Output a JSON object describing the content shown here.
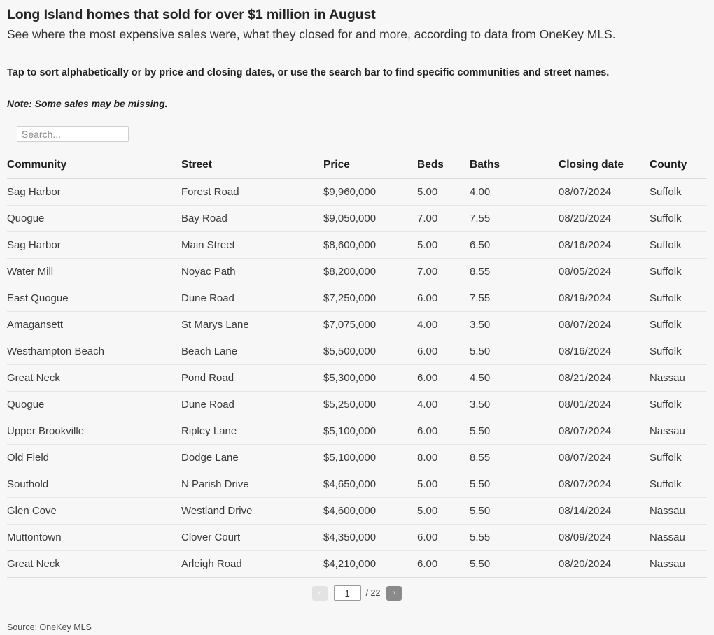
{
  "headline": "Long Island homes that sold for over $1 million in August",
  "subhead": "See where the most expensive sales were, what they closed for and more, according to data from OneKey MLS.",
  "instruction": "Tap to sort alphabetically or by price and closing dates, or use the search bar to find specific communities and street names.",
  "note": "Note: Some sales may be missing.",
  "search": {
    "placeholder": "Search...",
    "value": ""
  },
  "table": {
    "columns": [
      {
        "key": "community",
        "label": "Community"
      },
      {
        "key": "street",
        "label": "Street"
      },
      {
        "key": "price",
        "label": "Price"
      },
      {
        "key": "beds",
        "label": "Beds"
      },
      {
        "key": "baths",
        "label": "Baths"
      },
      {
        "key": "closing_date",
        "label": "Closing date"
      },
      {
        "key": "county",
        "label": "County"
      }
    ],
    "rows": [
      {
        "community": "Sag Harbor",
        "street": "Forest Road",
        "price": "$9,960,000",
        "beds": "5.00",
        "baths": "4.00",
        "closing_date": "08/07/2024",
        "county": "Suffolk"
      },
      {
        "community": "Quogue",
        "street": "Bay Road",
        "price": "$9,050,000",
        "beds": "7.00",
        "baths": "7.55",
        "closing_date": "08/20/2024",
        "county": "Suffolk"
      },
      {
        "community": "Sag Harbor",
        "street": "Main Street",
        "price": "$8,600,000",
        "beds": "5.00",
        "baths": "6.50",
        "closing_date": "08/16/2024",
        "county": "Suffolk"
      },
      {
        "community": "Water Mill",
        "street": "Noyac Path",
        "price": "$8,200,000",
        "beds": "7.00",
        "baths": "8.55",
        "closing_date": "08/05/2024",
        "county": "Suffolk"
      },
      {
        "community": "East Quogue",
        "street": "Dune Road",
        "price": "$7,250,000",
        "beds": "6.00",
        "baths": "7.55",
        "closing_date": "08/19/2024",
        "county": "Suffolk"
      },
      {
        "community": "Amagansett",
        "street": "St Marys Lane",
        "price": "$7,075,000",
        "beds": "4.00",
        "baths": "3.50",
        "closing_date": "08/07/2024",
        "county": "Suffolk"
      },
      {
        "community": "Westhampton Beach",
        "street": "Beach Lane",
        "price": "$5,500,000",
        "beds": "6.00",
        "baths": "5.50",
        "closing_date": "08/16/2024",
        "county": "Suffolk"
      },
      {
        "community": "Great Neck",
        "street": "Pond Road",
        "price": "$5,300,000",
        "beds": "6.00",
        "baths": "4.50",
        "closing_date": "08/21/2024",
        "county": "Nassau"
      },
      {
        "community": "Quogue",
        "street": "Dune Road",
        "price": "$5,250,000",
        "beds": "4.00",
        "baths": "3.50",
        "closing_date": "08/01/2024",
        "county": "Suffolk"
      },
      {
        "community": "Upper Brookville",
        "street": "Ripley Lane",
        "price": "$5,100,000",
        "beds": "6.00",
        "baths": "5.50",
        "closing_date": "08/07/2024",
        "county": "Nassau"
      },
      {
        "community": "Old Field",
        "street": "Dodge Lane",
        "price": "$5,100,000",
        "beds": "8.00",
        "baths": "8.55",
        "closing_date": "08/07/2024",
        "county": "Suffolk"
      },
      {
        "community": "Southold",
        "street": "N Parish Drive",
        "price": "$4,650,000",
        "beds": "5.00",
        "baths": "5.50",
        "closing_date": "08/07/2024",
        "county": "Suffolk"
      },
      {
        "community": "Glen Cove",
        "street": "Westland Drive",
        "price": "$4,600,000",
        "beds": "5.00",
        "baths": "5.50",
        "closing_date": "08/14/2024",
        "county": "Nassau"
      },
      {
        "community": "Muttontown",
        "street": "Clover Court",
        "price": "$4,350,000",
        "beds": "6.00",
        "baths": "5.55",
        "closing_date": "08/09/2024",
        "county": "Nassau"
      },
      {
        "community": "Great Neck",
        "street": "Arleigh Road",
        "price": "$4,210,000",
        "beds": "6.00",
        "baths": "5.50",
        "closing_date": "08/20/2024",
        "county": "Nassau"
      }
    ]
  },
  "pagination": {
    "prev_label": "‹",
    "next_label": "›",
    "current_page": "1",
    "total_pages_label": "/ 22"
  },
  "source": "Source: OneKey MLS",
  "colors": {
    "background": "#f7f7f7",
    "text": "#2b2b2b",
    "row_border": "#e6e6e6",
    "header_border": "#dcdcdc",
    "pager_next": "#8a8a8a",
    "pager_prev": "#e3e3e3"
  }
}
